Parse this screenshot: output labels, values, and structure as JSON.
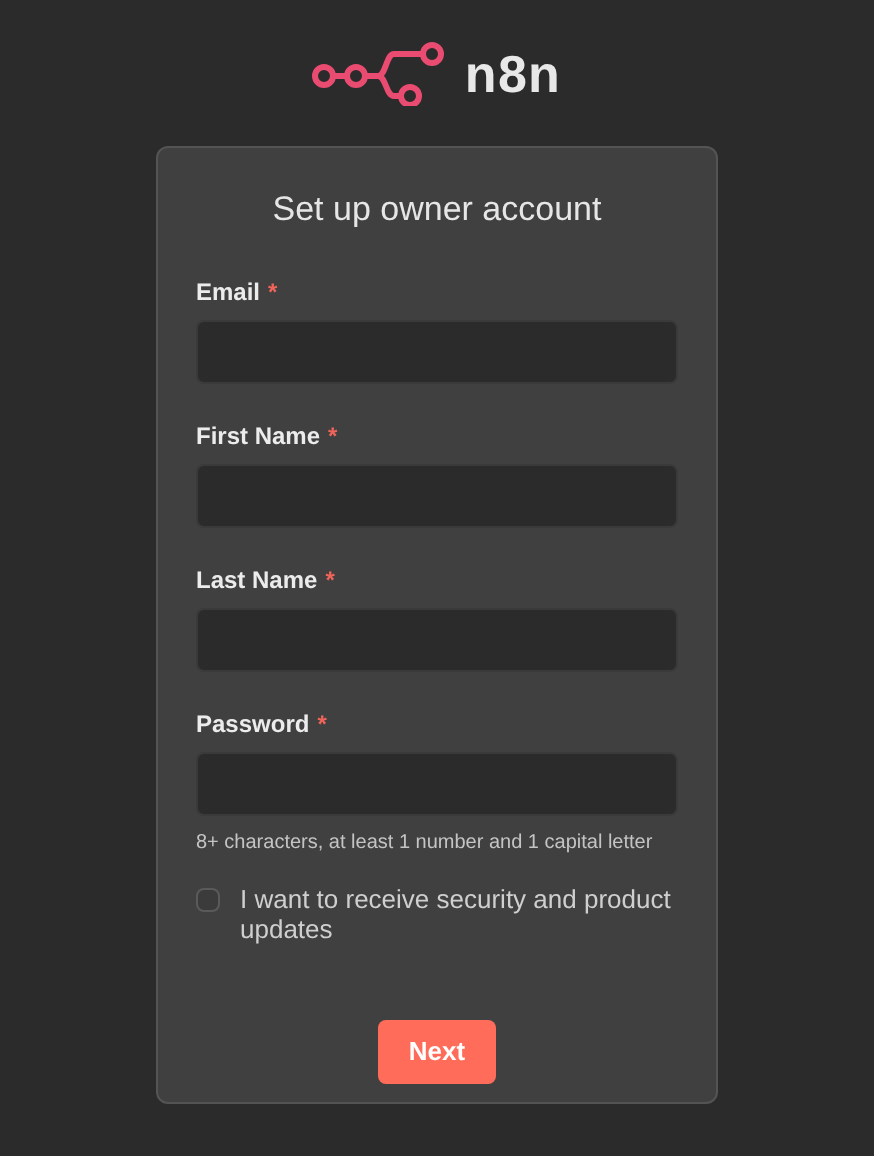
{
  "logo": {
    "text": "n8n"
  },
  "form": {
    "title": "Set up owner account",
    "fields": [
      {
        "label": "Email",
        "required_mark": "*"
      },
      {
        "label": "First Name",
        "required_mark": "*"
      },
      {
        "label": "Last Name",
        "required_mark": "*"
      },
      {
        "label": "Password",
        "required_mark": "*",
        "hint": "8+ characters, at least 1 number and 1 capital letter"
      }
    ],
    "checkbox": {
      "label": "I want to receive security and product updates",
      "checked": false
    },
    "submit": {
      "label": "Next"
    }
  }
}
